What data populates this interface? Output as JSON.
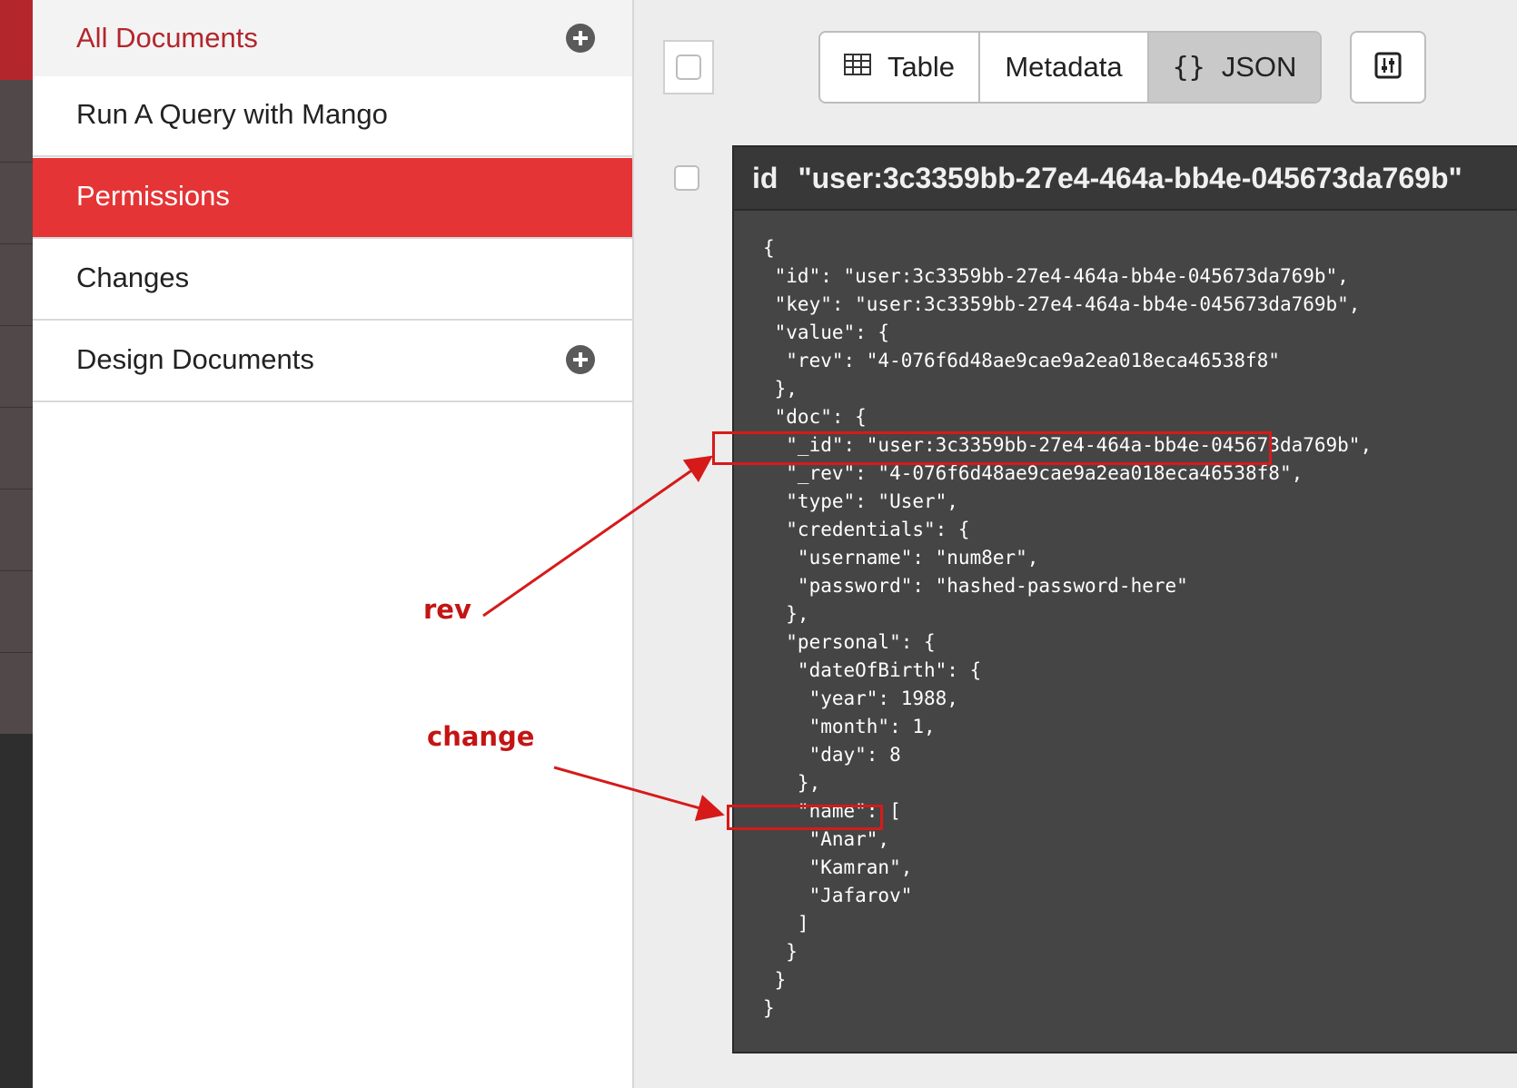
{
  "sidebar": {
    "items": [
      {
        "label": "All Documents",
        "has_add": true,
        "state": "current"
      },
      {
        "label": "Run A Query with Mango",
        "has_add": false,
        "state": "normal"
      },
      {
        "label": "Permissions",
        "has_add": false,
        "state": "selected"
      },
      {
        "label": "Changes",
        "has_add": false,
        "state": "normal"
      },
      {
        "label": "Design Documents",
        "has_add": true,
        "state": "normal"
      }
    ]
  },
  "toolbar": {
    "views": [
      {
        "label": "Table",
        "icon": "table-icon",
        "active": false
      },
      {
        "label": "Metadata",
        "icon": "",
        "active": false
      },
      {
        "label": "JSON",
        "icon": "braces-icon",
        "active": true
      }
    ],
    "braces_glyph": "{}",
    "settings_icon": "column-settings-icon"
  },
  "document": {
    "id_key": "id",
    "id_value": "\"user:3c3359bb-27e4-464a-bb4e-045673da769b\"",
    "json_lines": [
      "{",
      " \"id\": \"user:3c3359bb-27e4-464a-bb4e-045673da769b\",",
      " \"key\": \"user:3c3359bb-27e4-464a-bb4e-045673da769b\",",
      " \"value\": {",
      "  \"rev\": \"4-076f6d48ae9cae9a2ea018eca46538f8\"",
      " },",
      " \"doc\": {",
      "  \"_id\": \"user:3c3359bb-27e4-464a-bb4e-045673da769b\",",
      "  \"_rev\": \"4-076f6d48ae9cae9a2ea018eca46538f8\",",
      "  \"type\": \"User\",",
      "  \"credentials\": {",
      "   \"username\": \"num8er\",",
      "   \"password\": \"hashed-password-here\"",
      "  },",
      "  \"personal\": {",
      "   \"dateOfBirth\": {",
      "    \"year\": 1988,",
      "    \"month\": 1,",
      "    \"day\": 8",
      "   },",
      "   \"name\": [",
      "    \"Anar\",",
      "    \"Kamran\",",
      "    \"Jafarov\"",
      "   ]",
      "  }",
      " }",
      "}"
    ]
  },
  "annotations": {
    "rev_label": "rev",
    "change_label": "change",
    "color": "#d61a1a"
  },
  "colors": {
    "accent": "#e53435",
    "brand_dark_red": "#b3262c",
    "panel_bg": "#454545"
  }
}
